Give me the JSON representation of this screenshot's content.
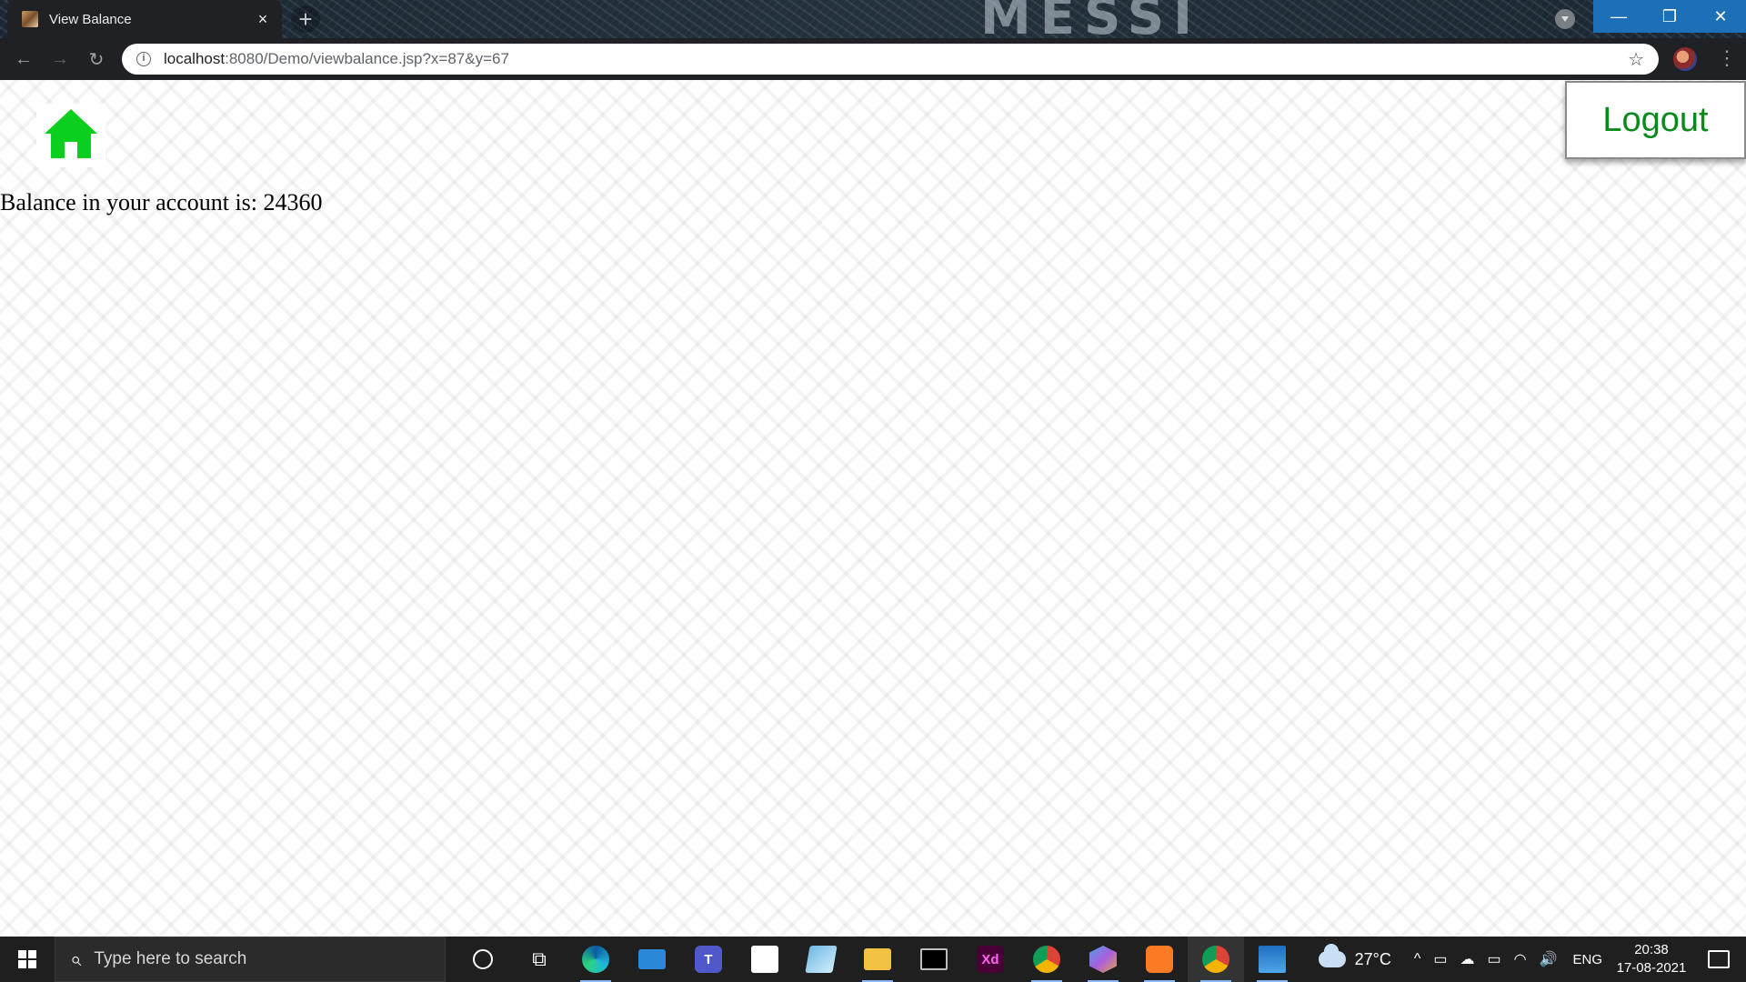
{
  "browser": {
    "tab_title": "View Balance",
    "tab_close": "×",
    "new_tab": "+",
    "url_host": "localhost",
    "url_rest": ":8080/Demo/viewbalance.jsp?x=87&y=67",
    "info_icon": "i",
    "star_icon": "☆",
    "menu_icon": "⋮",
    "back_icon": "←",
    "forward_icon": "→",
    "reload_icon": "↻",
    "window_buttons": {
      "minimize": "—",
      "restore": "❐",
      "close": "✕"
    },
    "wallpaper_text": "MESSI"
  },
  "page": {
    "home_icon": "home-icon",
    "home_color": "#0bcf1f",
    "logout_label": "Logout",
    "logout_color": "#0a8a1a",
    "balance_text": "Balance in your account is: 24360"
  },
  "taskbar": {
    "search_placeholder": "Type here to search",
    "search_icon": "⌕",
    "taskview_icon": "⧉",
    "xd_label": "Xd",
    "teams_label": "T",
    "weather": "27°C",
    "tray_chevron": "^",
    "tray_glyphs": [
      "▭",
      "☁",
      "▭",
      "◠",
      "🔊"
    ],
    "language": "ENG",
    "time": "20:38",
    "date": "17-08-2021"
  }
}
